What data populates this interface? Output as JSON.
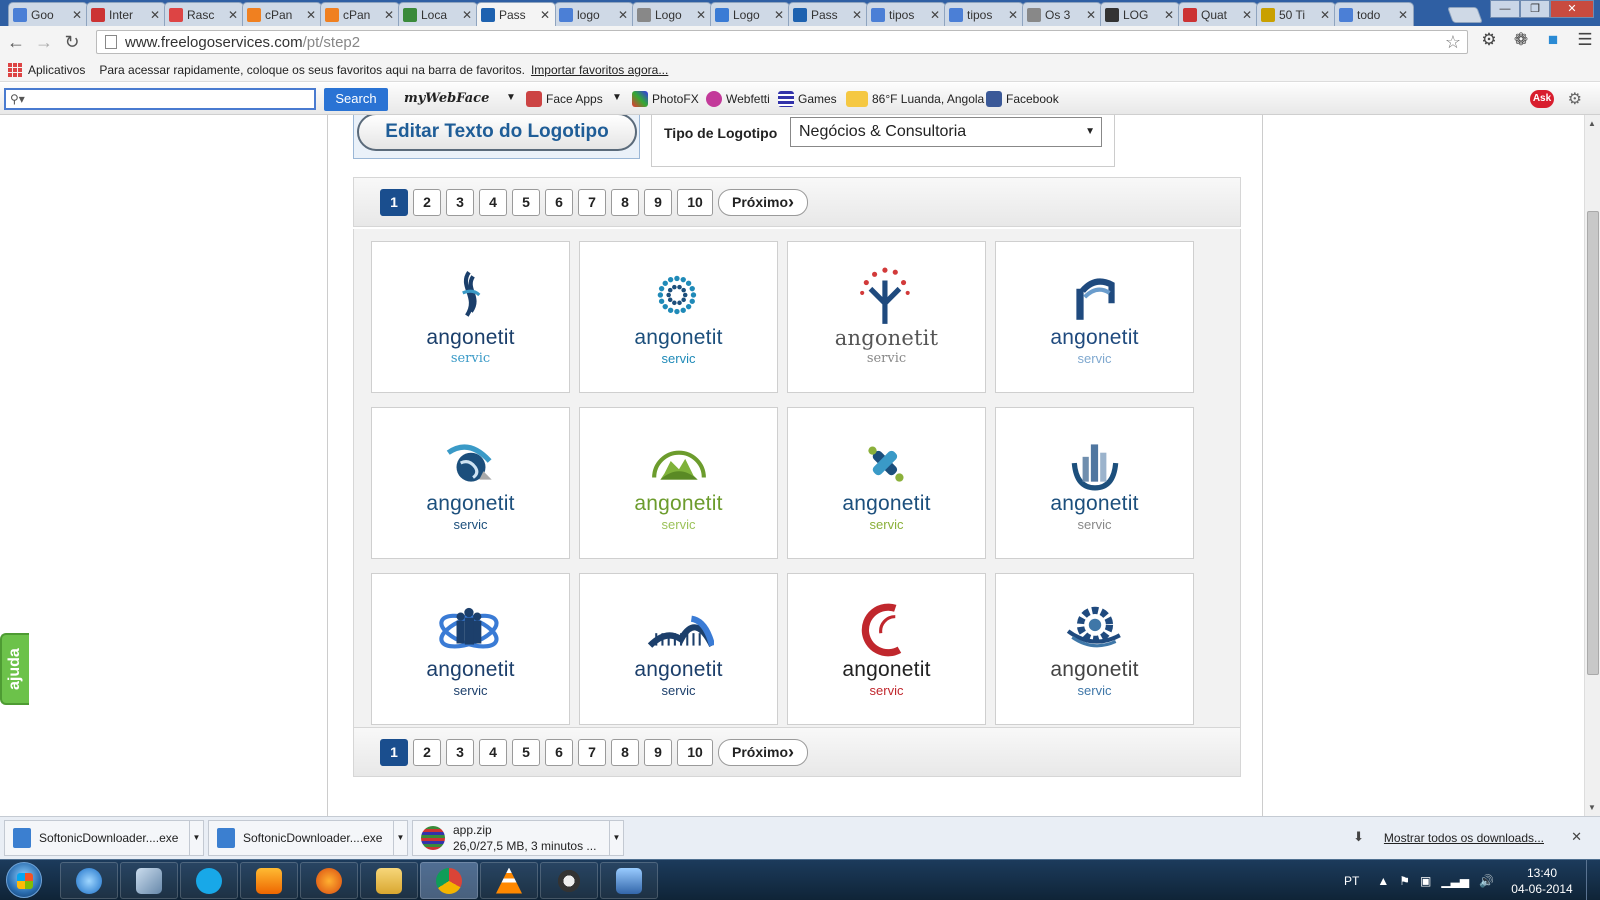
{
  "browser": {
    "tabs": [
      {
        "title": "Goo",
        "color": "#4b7fd6"
      },
      {
        "title": "Inter",
        "color": "#c33"
      },
      {
        "title": "Rasc",
        "color": "#d44"
      },
      {
        "title": "cPan",
        "color": "#f08020"
      },
      {
        "title": "cPan",
        "color": "#f08020"
      },
      {
        "title": "Loca",
        "color": "#3a8a3a"
      },
      {
        "title": "Pass",
        "color": "#1e62b0",
        "active": true
      },
      {
        "title": "logo",
        "color": "#4b7fd6"
      },
      {
        "title": "Logo",
        "color": "#888"
      },
      {
        "title": "Logo",
        "color": "#3a7bd5"
      },
      {
        "title": "Pass",
        "color": "#1e62b0"
      },
      {
        "title": "tipos",
        "color": "#4b7fd6"
      },
      {
        "title": "tipos",
        "color": "#4b7fd6"
      },
      {
        "title": "Os 3",
        "color": "#888"
      },
      {
        "title": "LOG",
        "color": "#333"
      },
      {
        "title": "Quat",
        "color": "#c33"
      },
      {
        "title": "50 Ti",
        "color": "#c9a000"
      },
      {
        "title": "todo",
        "color": "#4b7fd6"
      }
    ],
    "url_domain": "www.freelogoservices.com",
    "url_path": "/pt/step2",
    "bookmarks": {
      "apps_label": "Aplicativos",
      "hint": "Para acessar rapidamente, coloque os seus favoritos aqui na barra de favoritos.",
      "import_link": "Importar favoritos agora..."
    },
    "ask_toolbar": {
      "search_button": "Search",
      "mywebface": "myWebFace",
      "items": [
        "Face Apps",
        "PhotoFX",
        "Webfetti",
        "Games",
        "86°F Luanda, Angola",
        "Facebook"
      ],
      "ask_logo": "Ask"
    }
  },
  "page": {
    "edit_text_button": "Editar Texto do Logotipo",
    "logo_type_label": "Tipo de Logotipo",
    "logo_type_value": "Negócios & Consultoria",
    "pages": [
      "1",
      "2",
      "3",
      "4",
      "5",
      "6",
      "7",
      "8",
      "9",
      "10"
    ],
    "current_page": "1",
    "next_label": "Próximo",
    "help_tab": "ajuda",
    "logos": [
      {
        "brand": "angonetit",
        "sub": "servic",
        "brand_color": "#1b3f6b",
        "sub_color": "#3a9ac7"
      },
      {
        "brand": "angonetit",
        "sub": "servic",
        "brand_color": "#1c4f7c",
        "sub_color": "#1f8ab8"
      },
      {
        "brand": "angonetit",
        "sub": "servic",
        "brand_color": "#555555",
        "sub_color": "#888888"
      },
      {
        "brand": "angonetit",
        "sub": "servic",
        "brand_color": "#1f4a7e",
        "sub_color": "#7fa8cf"
      },
      {
        "brand": "angonetit",
        "sub": "servic",
        "brand_color": "#1c4f7c",
        "sub_color": "#1c4f7c"
      },
      {
        "brand": "angonetit",
        "sub": "servic",
        "brand_color": "#6c9c2d",
        "sub_color": "#9cc25a"
      },
      {
        "brand": "angonetit",
        "sub": "servic",
        "brand_color": "#1c4f7c",
        "sub_color": "#8bb03a"
      },
      {
        "brand": "angonetit",
        "sub": "servic",
        "brand_color": "#1c4f7c",
        "sub_color": "#888888"
      },
      {
        "brand": "angonetit",
        "sub": "servic",
        "brand_color": "#1c3f6b",
        "sub_color": "#1c3f6b"
      },
      {
        "brand": "angonetit",
        "sub": "servic",
        "brand_color": "#1c3f6b",
        "sub_color": "#1c3f6b"
      },
      {
        "brand": "angonetit",
        "sub": "servic",
        "brand_color": "#222222",
        "sub_color": "#c0272d"
      },
      {
        "brand": "angonetit",
        "sub": "servic",
        "brand_color": "#444444",
        "sub_color": "#3f77a8"
      }
    ]
  },
  "downloads": {
    "items": [
      {
        "name": "SoftonicDownloader....exe",
        "status": ""
      },
      {
        "name": "SoftonicDownloader....exe",
        "status": ""
      },
      {
        "name": "app.zip",
        "status": "26,0/27,5 MB, 3 minutos ..."
      }
    ],
    "show_all": "Mostrar todos os downloads..."
  },
  "taskbar": {
    "language": "PT",
    "time": "13:40",
    "date": "04-06-2014"
  }
}
